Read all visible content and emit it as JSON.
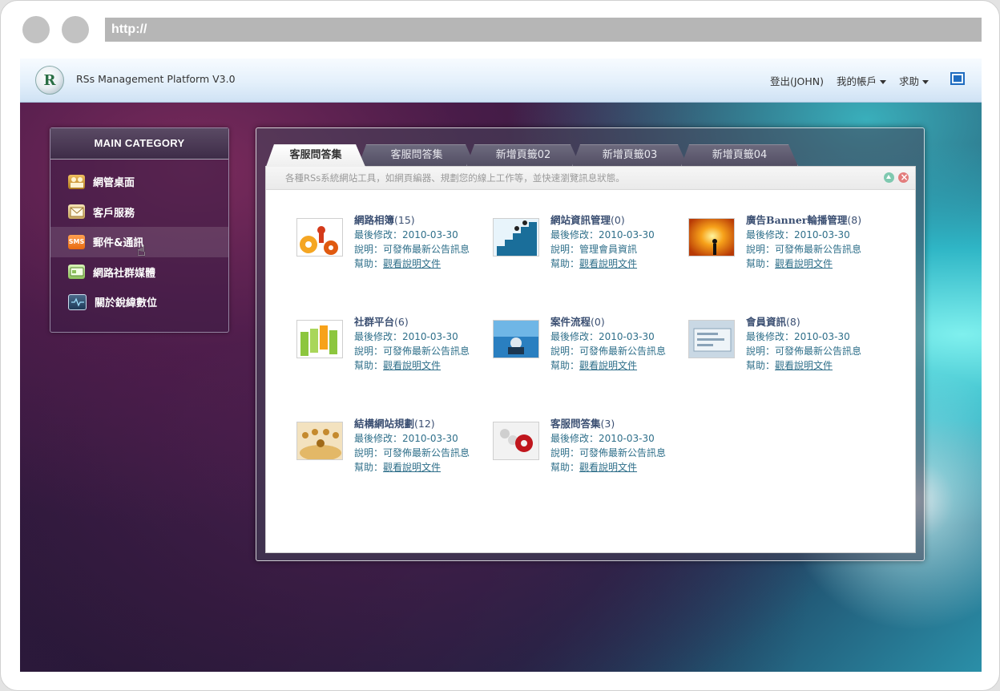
{
  "browser": {
    "url": "http://"
  },
  "topbar": {
    "title": "RSs Management Platform V3.0",
    "logout": "登出(JOHN)",
    "account": "我的帳戶",
    "help": "求助",
    "logo_letter": "R"
  },
  "sidebar": {
    "heading": "MAIN CATEGORY",
    "items": [
      {
        "label": "網管桌面",
        "icon": "users-icon"
      },
      {
        "label": "客戶服務",
        "icon": "envelope-icon"
      },
      {
        "label": "郵件&通訊",
        "icon": "sms-icon",
        "icon_text": "SMS"
      },
      {
        "label": "網路社群媒體",
        "icon": "card-icon"
      },
      {
        "label": "關於銳緯數位",
        "icon": "pulse-icon"
      }
    ]
  },
  "tabs": [
    {
      "label": "客服問答集",
      "active": true
    },
    {
      "label": "客服問答集",
      "active": false
    },
    {
      "label": "新增頁籤02",
      "active": false
    },
    {
      "label": "新增頁籤03",
      "active": false
    },
    {
      "label": "新增頁籤04",
      "active": false
    }
  ],
  "description": "各種RSs系統網站工具，如網頁編器、規劃您的線上工作等，並快速瀏覽訊息狀態。",
  "cards": [
    {
      "title": "網路相簿",
      "count": "(15)",
      "modified": "最後修改：2010-03-30",
      "desc": "說明：可發佈最新公告訊息",
      "help_prefix": "幫助：",
      "help_link": "觀看說明文件"
    },
    {
      "title": "網站資訊管理",
      "count": "(0)",
      "modified": "最後修改：2010-03-30",
      "desc": "說明：管理會員資訊",
      "help_prefix": "幫助：",
      "help_link": "觀看說明文件"
    },
    {
      "title": "廣告Banner輪播管理",
      "count": "(8)",
      "modified": "最後修改：2010-03-30",
      "desc": "說明：可發佈最新公告訊息",
      "help_prefix": "幫助：",
      "help_link": "觀看說明文件"
    },
    {
      "title": "社群平台",
      "count": "(6)",
      "modified": "最後修改：2010-03-30",
      "desc": "說明：可發佈最新公告訊息",
      "help_prefix": "幫助：",
      "help_link": "觀看說明文件"
    },
    {
      "title": "案件流程",
      "count": "(0)",
      "modified": "最後修改：2010-03-30",
      "desc": "說明：可發佈最新公告訊息",
      "help_prefix": "幫助：",
      "help_link": "觀看說明文件"
    },
    {
      "title": "會員資訊",
      "count": "(8)",
      "modified": "最後修改：2010-03-30",
      "desc": "說明：可發佈最新公告訊息",
      "help_prefix": "幫助：",
      "help_link": "觀看說明文件"
    },
    {
      "title": "結構網站規劃",
      "count": "(12)",
      "modified": "最後修改：2010-03-30",
      "desc": "說明：可發佈最新公告訊息",
      "help_prefix": "幫助：",
      "help_link": "觀看說明文件"
    },
    {
      "title": "客服問答集",
      "count": "(3)",
      "modified": "最後修改：2010-03-30",
      "desc": "說明：可發佈最新公告訊息",
      "help_prefix": "幫助：",
      "help_link": "觀看說明文件"
    }
  ]
}
